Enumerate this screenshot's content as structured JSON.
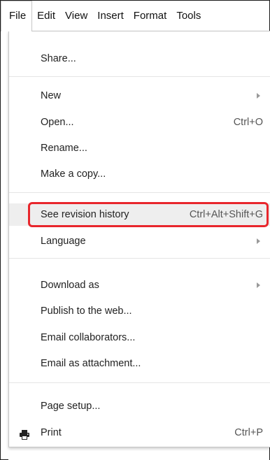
{
  "menubar": {
    "items": [
      "File",
      "Edit",
      "View",
      "Insert",
      "Format",
      "Tools"
    ]
  },
  "file_menu": {
    "share": "Share...",
    "new": "New",
    "open": "Open...",
    "open_shortcut": "Ctrl+O",
    "rename": "Rename...",
    "make_copy": "Make a copy...",
    "revision_history": "See revision history",
    "revision_history_shortcut": "Ctrl+Alt+Shift+G",
    "language": "Language",
    "download_as": "Download as",
    "publish": "Publish to the web...",
    "email_collaborators": "Email collaborators...",
    "email_attachment": "Email as attachment...",
    "page_setup": "Page setup...",
    "print": "Print",
    "print_shortcut": "Ctrl+P"
  },
  "icons": {
    "submenu": "chevron-right-icon",
    "print": "printer-icon"
  },
  "colors": {
    "highlight_box": "#e8262c",
    "hover_row": "#eeeeee"
  }
}
